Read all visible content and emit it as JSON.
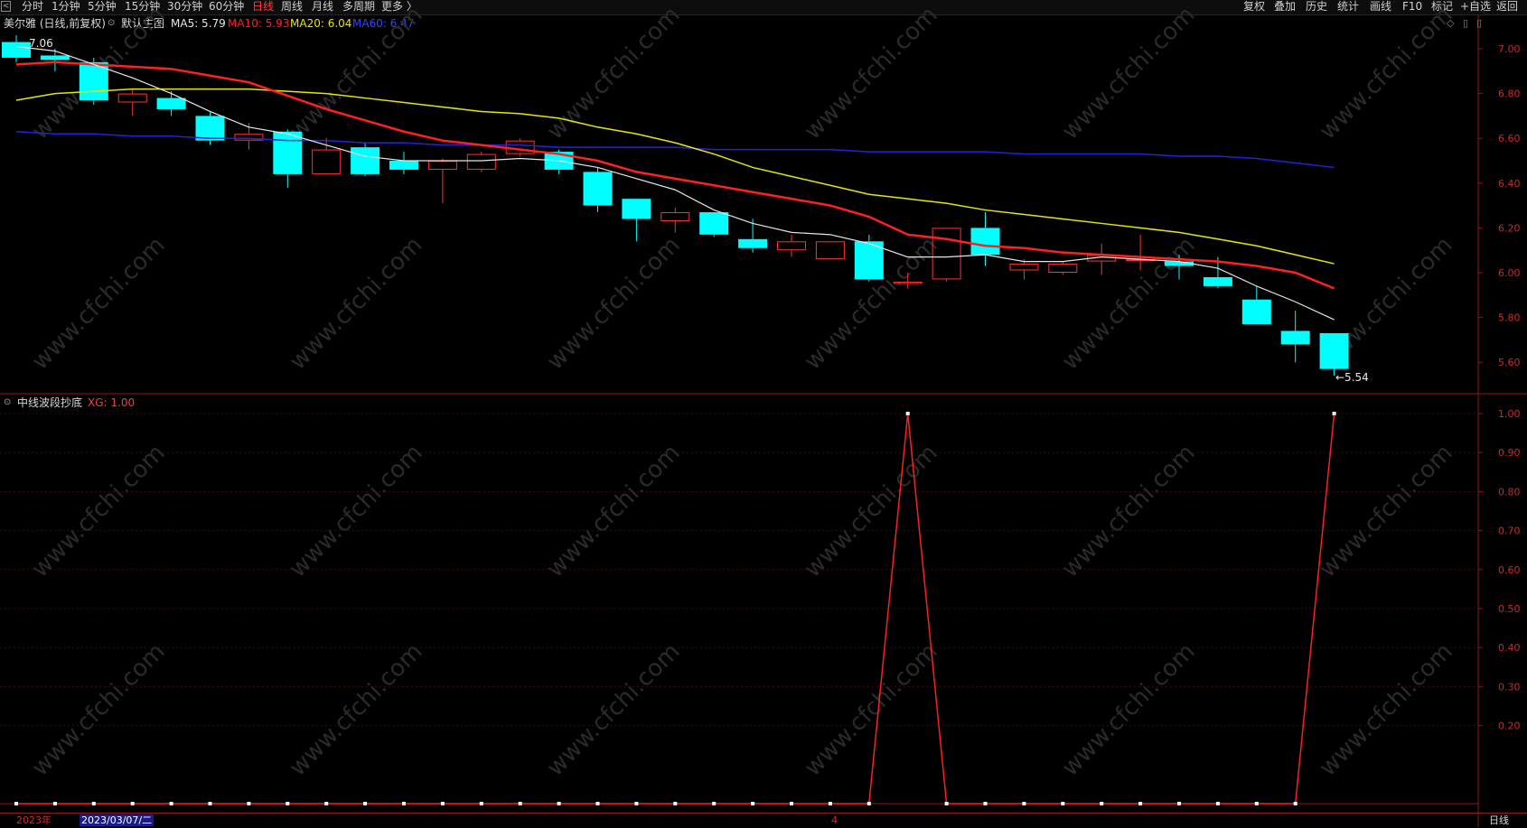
{
  "toolbar": {
    "left_items": [
      "分时",
      "1分钟",
      "5分钟",
      "15分钟",
      "30分钟",
      "60分钟",
      "日线",
      "周线",
      "月线",
      "多周期",
      "更多 〉"
    ],
    "active": "日线",
    "right_items": [
      "复权",
      "叠加",
      "历史",
      "统计",
      "画线",
      "F10",
      "标记",
      "+自选",
      "返回"
    ],
    "corner_icon": "left-arrow-icon"
  },
  "main": {
    "stock_title": "美尔雅 (日线,前复权)",
    "template_label": "默认主图",
    "ma5": "MA5: 5.79",
    "ma10": "MA10: 5.93",
    "ma20": "MA20: 6.04",
    "ma60": "MA60: 6.47",
    "high_label": "7.06",
    "low_label": "5.54",
    "y_ticks": [
      "7.00",
      "6.80",
      "6.60",
      "6.40",
      "6.20",
      "6.00",
      "5.80",
      "5.60"
    ]
  },
  "indicator": {
    "name": "中线波段抄底",
    "value": "XG: 1.00",
    "y_ticks": [
      "1.00",
      "0.90",
      "0.80",
      "0.70",
      "0.60",
      "0.50",
      "0.40",
      "0.30",
      "0.20"
    ]
  },
  "bottom": {
    "year_label": "2023年",
    "date_label": "2023/03/07/二",
    "month_marker": "4",
    "period_label": "日线"
  },
  "colors": {
    "up": "#ff3333",
    "down": "#00ffff",
    "ma5": "#e6e6e6",
    "ma10": "#ff2020",
    "ma20": "#e6e600",
    "ma60": "#2222dd",
    "xg": "#ff1e1e",
    "frame": "#8b1a1a"
  },
  "candles": [
    {
      "o": 7.03,
      "h": 7.06,
      "l": 6.94,
      "c": 6.96
    },
    {
      "o": 6.97,
      "h": 7.0,
      "l": 6.9,
      "c": 6.95
    },
    {
      "o": 6.94,
      "h": 6.96,
      "l": 6.75,
      "c": 6.77
    },
    {
      "o": 6.76,
      "h": 6.82,
      "l": 6.7,
      "c": 6.8
    },
    {
      "o": 6.78,
      "h": 6.81,
      "l": 6.7,
      "c": 6.73
    },
    {
      "o": 6.7,
      "h": 6.72,
      "l": 6.57,
      "c": 6.59
    },
    {
      "o": 6.59,
      "h": 6.67,
      "l": 6.55,
      "c": 6.62
    },
    {
      "o": 6.63,
      "h": 6.64,
      "l": 6.38,
      "c": 6.44
    },
    {
      "o": 6.44,
      "h": 6.6,
      "l": 6.44,
      "c": 6.55
    },
    {
      "o": 6.56,
      "h": 6.58,
      "l": 6.43,
      "c": 6.44
    },
    {
      "o": 6.5,
      "h": 6.54,
      "l": 6.44,
      "c": 6.46
    },
    {
      "o": 6.46,
      "h": 6.51,
      "l": 6.31,
      "c": 6.5
    },
    {
      "o": 6.46,
      "h": 6.54,
      "l": 6.45,
      "c": 6.53
    },
    {
      "o": 6.53,
      "h": 6.6,
      "l": 6.52,
      "c": 6.59
    },
    {
      "o": 6.54,
      "h": 6.55,
      "l": 6.44,
      "c": 6.46
    },
    {
      "o": 6.45,
      "h": 6.47,
      "l": 6.27,
      "c": 6.3
    },
    {
      "o": 6.33,
      "h": 6.33,
      "l": 6.14,
      "c": 6.24
    },
    {
      "o": 6.23,
      "h": 6.29,
      "l": 6.18,
      "c": 6.27
    },
    {
      "o": 6.27,
      "h": 6.27,
      "l": 6.16,
      "c": 6.17
    },
    {
      "o": 6.15,
      "h": 6.24,
      "l": 6.09,
      "c": 6.11
    },
    {
      "o": 6.1,
      "h": 6.17,
      "l": 6.07,
      "c": 6.14
    },
    {
      "o": 6.06,
      "h": 6.14,
      "l": 6.06,
      "c": 6.14
    },
    {
      "o": 6.14,
      "h": 6.17,
      "l": 5.96,
      "c": 5.97
    },
    {
      "o": 5.95,
      "h": 6.0,
      "l": 5.93,
      "c": 5.96
    },
    {
      "o": 5.97,
      "h": 6.2,
      "l": 5.96,
      "c": 6.2
    },
    {
      "o": 6.2,
      "h": 6.27,
      "l": 6.03,
      "c": 6.08
    },
    {
      "o": 6.01,
      "h": 6.06,
      "l": 5.97,
      "c": 6.04
    },
    {
      "o": 6.0,
      "h": 6.05,
      "l": 5.99,
      "c": 6.04
    },
    {
      "o": 6.05,
      "h": 6.13,
      "l": 5.99,
      "c": 6.08
    },
    {
      "o": 6.06,
      "h": 6.17,
      "l": 6.01,
      "c": 6.06
    },
    {
      "o": 6.05,
      "h": 6.08,
      "l": 5.97,
      "c": 6.03
    },
    {
      "o": 5.98,
      "h": 6.07,
      "l": 5.93,
      "c": 5.94
    },
    {
      "o": 5.88,
      "h": 5.94,
      "l": 5.77,
      "c": 5.77
    },
    {
      "o": 5.74,
      "h": 5.83,
      "l": 5.6,
      "c": 5.68
    },
    {
      "o": 5.73,
      "h": 5.73,
      "l": 5.54,
      "c": 5.57
    }
  ],
  "ma5_line": [
    7.01,
    6.99,
    6.93,
    6.87,
    6.8,
    6.72,
    6.65,
    6.62,
    6.57,
    6.52,
    6.5,
    6.5,
    6.5,
    6.51,
    6.5,
    6.47,
    6.42,
    6.37,
    6.28,
    6.22,
    6.18,
    6.17,
    6.13,
    6.07,
    6.07,
    6.08,
    6.05,
    6.05,
    6.07,
    6.06,
    6.05,
    6.02,
    5.94,
    5.87,
    5.79
  ],
  "ma10_line": [
    6.93,
    6.94,
    6.93,
    6.92,
    6.91,
    6.88,
    6.85,
    6.79,
    6.73,
    6.68,
    6.63,
    6.59,
    6.57,
    6.55,
    6.53,
    6.5,
    6.45,
    6.42,
    6.39,
    6.36,
    6.33,
    6.3,
    6.25,
    6.17,
    6.15,
    6.12,
    6.11,
    6.09,
    6.08,
    6.07,
    6.06,
    6.05,
    6.03,
    6.0,
    5.93
  ],
  "ma20_line": [
    6.77,
    6.8,
    6.81,
    6.82,
    6.82,
    6.82,
    6.82,
    6.81,
    6.8,
    6.78,
    6.76,
    6.74,
    6.72,
    6.71,
    6.69,
    6.65,
    6.62,
    6.58,
    6.53,
    6.47,
    6.43,
    6.39,
    6.35,
    6.33,
    6.31,
    6.28,
    6.26,
    6.24,
    6.22,
    6.2,
    6.18,
    6.15,
    6.12,
    6.08,
    6.04
  ],
  "ma60_line": [
    6.63,
    6.62,
    6.62,
    6.61,
    6.61,
    6.6,
    6.6,
    6.59,
    6.59,
    6.58,
    6.58,
    6.57,
    6.57,
    6.57,
    6.56,
    6.56,
    6.56,
    6.56,
    6.55,
    6.55,
    6.55,
    6.55,
    6.54,
    6.54,
    6.54,
    6.54,
    6.53,
    6.53,
    6.53,
    6.53,
    6.52,
    6.52,
    6.51,
    6.49,
    6.47
  ],
  "xg_values": [
    0,
    0,
    0,
    0,
    0,
    0,
    0,
    0,
    0,
    0,
    0,
    0,
    0,
    0,
    0,
    0,
    0,
    0,
    0,
    0,
    0,
    0,
    0,
    1,
    0,
    0,
    0,
    0,
    0,
    0,
    0,
    0,
    0,
    0,
    1
  ],
  "watermark": "www.cfchi.com"
}
